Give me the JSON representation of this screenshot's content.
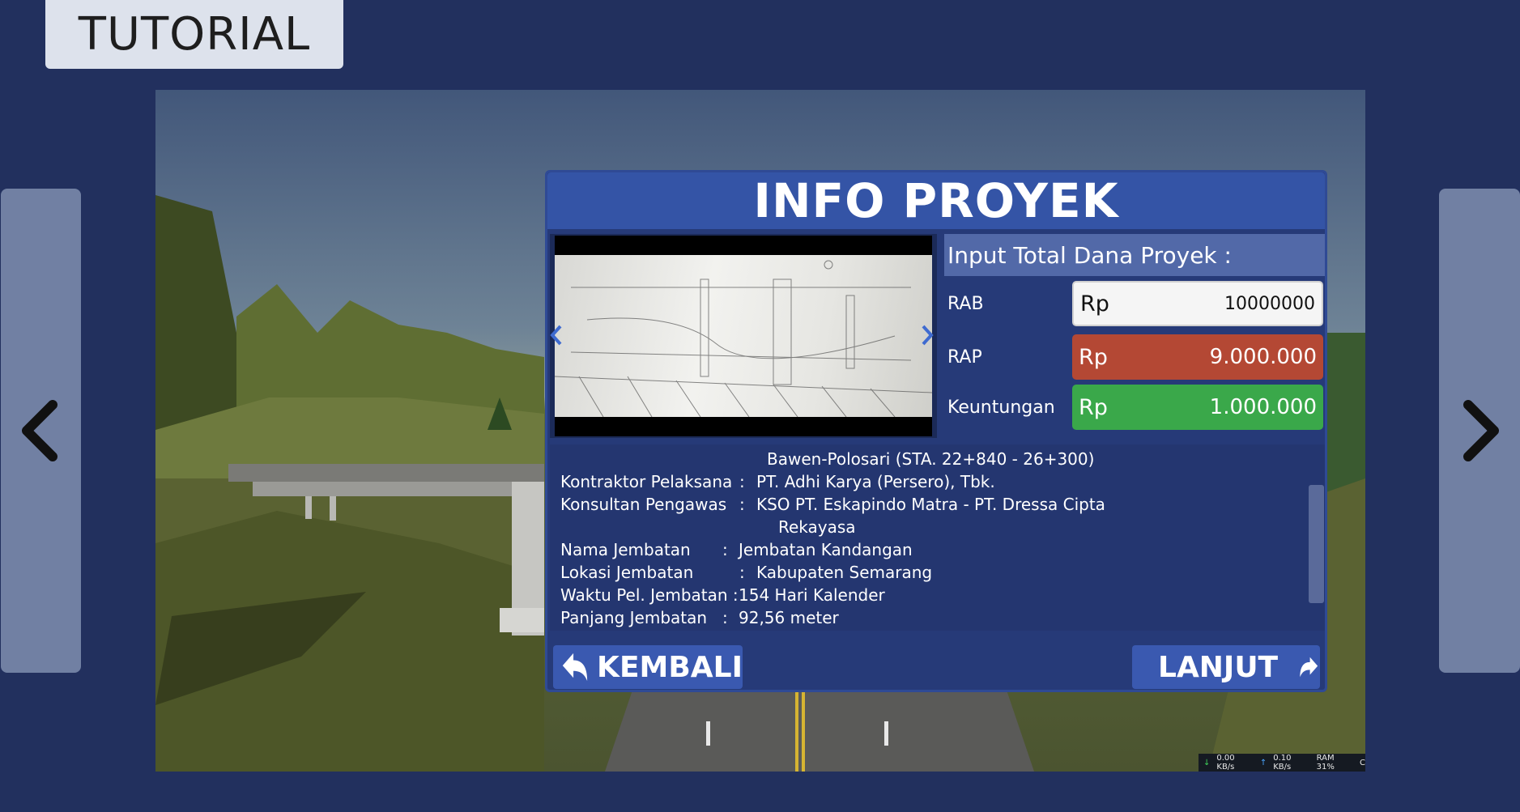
{
  "header": {
    "title": "TUTORIAL"
  },
  "side_nav": {
    "prev_icon": "chevron-left-icon",
    "next_icon": "chevron-right-icon"
  },
  "info": {
    "title": "INFO PROYEK",
    "fund": {
      "title": "Input Total Dana Proyek :",
      "rows": [
        {
          "label": "RAB",
          "currency": "Rp",
          "value": "10000000",
          "color": "#f5f5f5"
        },
        {
          "label": "RAP",
          "currency": "Rp",
          "value": "9.000.000",
          "color": "#b44834"
        },
        {
          "label": "Keuntungan",
          "currency": "Rp",
          "value": "1.000.000",
          "color": "#3aa84a"
        }
      ]
    },
    "details": {
      "cut_line": "Bawen-Polosari (STA. 22+840 - 26+300)",
      "kontraktor_label": "Kontraktor Pelaksana",
      "kontraktor_sep": ":",
      "kontraktor_value": "PT. Adhi Karya (Persero), Tbk.",
      "konsultan_label": "Konsultan Pengawas",
      "konsultan_sep": ":",
      "konsultan_value": "KSO PT. Eskapindo Matra - PT. Dressa Cipta",
      "konsultan_value_cont": "Rekayasa",
      "nama_label": "Nama Jembatan",
      "nama_sep": ":",
      "nama_value": "Jembatan Kandangan",
      "lokasi_label": "Lokasi Jembatan",
      "lokasi_sep": ":",
      "lokasi_value": "Kabupaten Semarang",
      "waktu_label": "Waktu Pel. Jembatan :",
      "waktu_value": "154 Hari Kalender",
      "panjang_label": "Panjang Jembatan",
      "panjang_sep": ":",
      "panjang_value": "92,56 meter"
    },
    "buttons": {
      "back": "KEMBALI",
      "next": "LANJUT"
    }
  },
  "netstat": {
    "download": "0.00 KB/s",
    "upload": "0.10 KB/s",
    "ram": "RAM 31%",
    "extra": "C"
  },
  "colors": {
    "background": "#22305e",
    "panel": "#263a78",
    "header": "#3454a6",
    "button": "#3a59b0"
  }
}
